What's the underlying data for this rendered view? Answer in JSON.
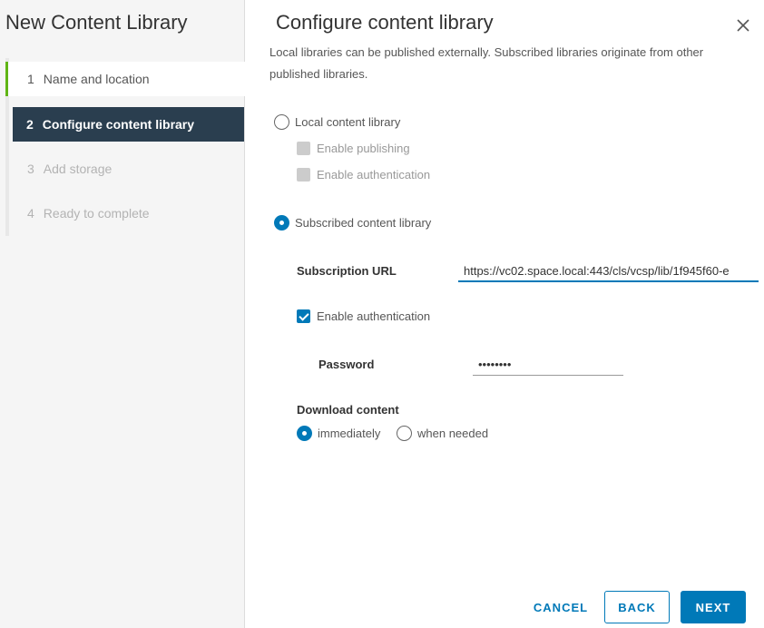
{
  "wizard": {
    "title": "New Content Library",
    "steps": [
      {
        "num": "1",
        "label": "Name and location"
      },
      {
        "num": "2",
        "label": "Configure content library"
      },
      {
        "num": "3",
        "label": "Add storage"
      },
      {
        "num": "4",
        "label": "Ready to complete"
      }
    ]
  },
  "page": {
    "title": "Configure content library",
    "description": "Local libraries can be published externally. Subscribed libraries originate from other published libraries."
  },
  "local_library": {
    "label": "Local content library",
    "enable_publishing": "Enable publishing",
    "enable_authentication": "Enable authentication"
  },
  "subscribed_library": {
    "label": "Subscribed content library",
    "subscription_url_label": "Subscription URL",
    "subscription_url_value": "https://vc02.space.local:443/cls/vcsp/lib/1f945f60-e",
    "enable_authentication": "Enable authentication",
    "password_label": "Password",
    "password_value": "••••••••",
    "download_content_label": "Download content",
    "download_immediately": "immediately",
    "download_when_needed": "when needed"
  },
  "footer": {
    "cancel": "CANCEL",
    "back": "BACK",
    "next": "NEXT"
  },
  "colors": {
    "accent": "#0079b8",
    "sidebar_active": "#2a3e4f",
    "step_done": "#60b515"
  }
}
